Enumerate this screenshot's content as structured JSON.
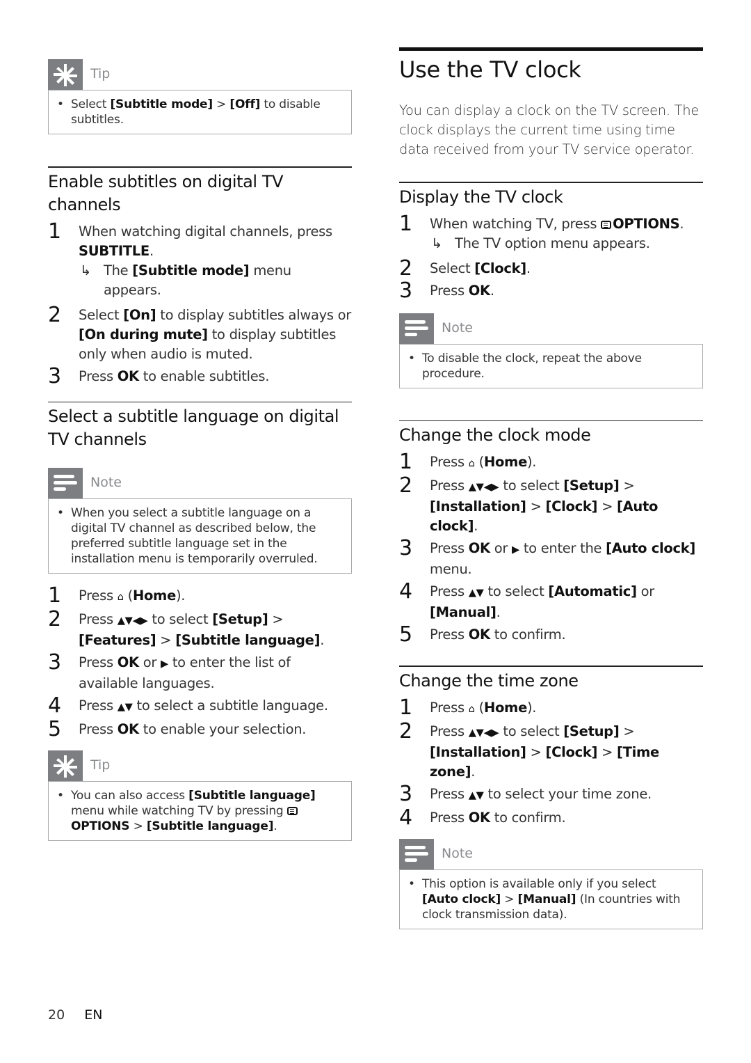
{
  "left": {
    "tip1": {
      "title": "Tip",
      "icon": "asterisk-icon",
      "items": [
        {
          "parts": [
            {
              "t": "Select ",
              "b": false
            },
            {
              "t": "[Subtitle mode]",
              "b": true
            },
            {
              "t": " > ",
              "b": false
            },
            {
              "t": "[Off]",
              "b": true
            },
            {
              "t": " to disable subtitles.",
              "b": false
            }
          ]
        }
      ]
    },
    "section1": {
      "title": "Enable subtitles on digital TV channels",
      "steps": [
        {
          "num": "1",
          "parts": [
            {
              "t": "When watching digital channels, press ",
              "b": false
            },
            {
              "t": "SUBTITLE",
              "b": true
            },
            {
              "t": ".",
              "b": false
            }
          ],
          "result": [
            {
              "t": "The ",
              "b": false
            },
            {
              "t": "[Subtitle mode]",
              "b": true
            },
            {
              "t": " menu appears.",
              "b": false
            }
          ]
        },
        {
          "num": "2",
          "parts": [
            {
              "t": "Select ",
              "b": false
            },
            {
              "t": "[On]",
              "b": true
            },
            {
              "t": " to display subtitles always or ",
              "b": false
            },
            {
              "t": "[On during mute]",
              "b": true
            },
            {
              "t": " to display subtitles only when audio is muted.",
              "b": false
            }
          ]
        },
        {
          "num": "3",
          "parts": [
            {
              "t": "Press ",
              "b": false
            },
            {
              "t": "OK",
              "b": true
            },
            {
              "t": " to enable subtitles.",
              "b": false
            }
          ]
        }
      ]
    },
    "section2": {
      "title": "Select a subtitle language on digital TV channels",
      "note": {
        "title": "Note",
        "icon": "note-lines-icon",
        "items": [
          {
            "parts": [
              {
                "t": "When you select a subtitle language on a digital TV channel as described below, the preferred subtitle language set in the installation menu is temporarily overruled.",
                "b": false
              }
            ]
          }
        ]
      },
      "steps": [
        {
          "num": "1",
          "parts": [
            {
              "t": "Press ",
              "b": false
            },
            {
              "t": "⌂",
              "b": false,
              "icon": "home-icon"
            },
            {
              "t": " (",
              "b": false
            },
            {
              "t": "Home",
              "b": true
            },
            {
              "t": ").",
              "b": false
            }
          ]
        },
        {
          "num": "2",
          "parts": [
            {
              "t": "Press ",
              "b": false
            },
            {
              "t": "▲▼◀▶",
              "b": false,
              "icon": "navigation-arrows-icon"
            },
            {
              "t": " to select ",
              "b": false
            },
            {
              "t": "[Setup]",
              "b": true
            },
            {
              "t": " > ",
              "b": false
            },
            {
              "t": "[Features]",
              "b": true
            },
            {
              "t": " > ",
              "b": false
            },
            {
              "t": "[Subtitle language]",
              "b": true
            },
            {
              "t": ".",
              "b": false
            }
          ]
        },
        {
          "num": "3",
          "parts": [
            {
              "t": "Press ",
              "b": false
            },
            {
              "t": "OK",
              "b": true
            },
            {
              "t": " or ",
              "b": false
            },
            {
              "t": "▶",
              "b": false,
              "icon": "right-arrow-icon"
            },
            {
              "t": " to enter the list of available languages.",
              "b": false
            }
          ]
        },
        {
          "num": "4",
          "parts": [
            {
              "t": "Press ",
              "b": false
            },
            {
              "t": "▲▼",
              "b": false,
              "icon": "up-down-arrows-icon"
            },
            {
              "t": " to select a subtitle language.",
              "b": false
            }
          ]
        },
        {
          "num": "5",
          "parts": [
            {
              "t": "Press ",
              "b": false
            },
            {
              "t": "OK",
              "b": true
            },
            {
              "t": " to enable your selection.",
              "b": false
            }
          ]
        }
      ],
      "tip": {
        "title": "Tip",
        "icon": "asterisk-icon",
        "items": [
          {
            "parts": [
              {
                "t": "You can also access ",
                "b": false
              },
              {
                "t": "[Subtitle language]",
                "b": true
              },
              {
                "t": " menu while watching TV by pressing ",
                "b": false
              },
              {
                "t": "",
                "b": false,
                "icon": "options-icon"
              },
              {
                "t": "OPTIONS",
                "b": true
              },
              {
                "t": " > ",
                "b": false
              },
              {
                "t": "[Subtitle language]",
                "b": true
              },
              {
                "t": ".",
                "b": false
              }
            ]
          }
        ]
      }
    }
  },
  "right": {
    "main_title": "Use the TV clock",
    "intro": "You can display a clock on the TV screen. The clock displays the current time using time data received from your TV service operator.",
    "section1": {
      "title": "Display the TV clock",
      "steps": [
        {
          "num": "1",
          "parts": [
            {
              "t": "When watching TV, press ",
              "b": false
            },
            {
              "t": "",
              "b": false,
              "icon": "options-icon"
            },
            {
              "t": "OPTIONS",
              "b": true
            },
            {
              "t": ".",
              "b": false
            }
          ],
          "result": [
            {
              "t": "The TV option menu appears.",
              "b": false
            }
          ]
        },
        {
          "num": "2",
          "parts": [
            {
              "t": "Select ",
              "b": false
            },
            {
              "t": "[Clock]",
              "b": true
            },
            {
              "t": ".",
              "b": false
            }
          ]
        },
        {
          "num": "3",
          "parts": [
            {
              "t": "Press ",
              "b": false
            },
            {
              "t": "OK",
              "b": true
            },
            {
              "t": ".",
              "b": false
            }
          ]
        }
      ],
      "note": {
        "title": "Note",
        "icon": "note-lines-icon",
        "items": [
          {
            "parts": [
              {
                "t": "To disable the clock, repeat the above procedure.",
                "b": false
              }
            ]
          }
        ]
      }
    },
    "section2": {
      "title": "Change the clock mode",
      "steps": [
        {
          "num": "1",
          "parts": [
            {
              "t": "Press ",
              "b": false
            },
            {
              "t": "⌂",
              "b": false,
              "icon": "home-icon"
            },
            {
              "t": " (",
              "b": false
            },
            {
              "t": "Home",
              "b": true
            },
            {
              "t": ").",
              "b": false
            }
          ]
        },
        {
          "num": "2",
          "parts": [
            {
              "t": "Press ",
              "b": false
            },
            {
              "t": "▲▼◀▶",
              "b": false,
              "icon": "navigation-arrows-icon"
            },
            {
              "t": " to select ",
              "b": false
            },
            {
              "t": "[Setup]",
              "b": true
            },
            {
              "t": " > ",
              "b": false
            },
            {
              "t": "[Installation]",
              "b": true
            },
            {
              "t": " > ",
              "b": false
            },
            {
              "t": "[Clock]",
              "b": true
            },
            {
              "t": " > ",
              "b": false
            },
            {
              "t": "[Auto clock]",
              "b": true
            },
            {
              "t": ".",
              "b": false
            }
          ]
        },
        {
          "num": "3",
          "parts": [
            {
              "t": "Press ",
              "b": false
            },
            {
              "t": "OK",
              "b": true
            },
            {
              "t": " or ",
              "b": false
            },
            {
              "t": "▶",
              "b": false,
              "icon": "right-arrow-icon"
            },
            {
              "t": " to enter the ",
              "b": false
            },
            {
              "t": "[Auto clock]",
              "b": true
            },
            {
              "t": " menu.",
              "b": false
            }
          ]
        },
        {
          "num": "4",
          "parts": [
            {
              "t": "Press ",
              "b": false
            },
            {
              "t": "▲▼",
              "b": false,
              "icon": "up-down-arrows-icon"
            },
            {
              "t": " to select ",
              "b": false
            },
            {
              "t": "[Automatic]",
              "b": true
            },
            {
              "t": " or ",
              "b": false
            },
            {
              "t": "[Manual]",
              "b": true
            },
            {
              "t": ".",
              "b": false
            }
          ]
        },
        {
          "num": "5",
          "parts": [
            {
              "t": "Press ",
              "b": false
            },
            {
              "t": "OK",
              "b": true
            },
            {
              "t": " to confirm.",
              "b": false
            }
          ]
        }
      ]
    },
    "section3": {
      "title": "Change the time zone",
      "steps": [
        {
          "num": "1",
          "parts": [
            {
              "t": "Press ",
              "b": false
            },
            {
              "t": "⌂",
              "b": false,
              "icon": "home-icon"
            },
            {
              "t": " (",
              "b": false
            },
            {
              "t": "Home",
              "b": true
            },
            {
              "t": ").",
              "b": false
            }
          ]
        },
        {
          "num": "2",
          "parts": [
            {
              "t": "Press ",
              "b": false
            },
            {
              "t": "▲▼◀▶",
              "b": false,
              "icon": "navigation-arrows-icon"
            },
            {
              "t": " to select ",
              "b": false
            },
            {
              "t": "[Setup]",
              "b": true
            },
            {
              "t": " > ",
              "b": false
            },
            {
              "t": "[Installation]",
              "b": true
            },
            {
              "t": " > ",
              "b": false
            },
            {
              "t": "[Clock]",
              "b": true
            },
            {
              "t": " > ",
              "b": false
            },
            {
              "t": "[Time zone]",
              "b": true
            },
            {
              "t": ".",
              "b": false
            }
          ]
        },
        {
          "num": "3",
          "parts": [
            {
              "t": "Press ",
              "b": false
            },
            {
              "t": "▲▼",
              "b": false,
              "icon": "up-down-arrows-icon"
            },
            {
              "t": " to select your time zone.",
              "b": false
            }
          ]
        },
        {
          "num": "4",
          "parts": [
            {
              "t": "Press ",
              "b": false
            },
            {
              "t": "OK",
              "b": true
            },
            {
              "t": " to confirm.",
              "b": false
            }
          ]
        }
      ],
      "note": {
        "title": "Note",
        "icon": "note-lines-icon",
        "items": [
          {
            "parts": [
              {
                "t": "This option is available only if you select ",
                "b": false
              },
              {
                "t": "[Auto clock]",
                "b": true
              },
              {
                "t": " > ",
                "b": false
              },
              {
                "t": "[Manual]",
                "b": true
              },
              {
                "t": " (In countries with clock transmission data).",
                "b": false
              }
            ]
          }
        ]
      }
    }
  },
  "footer": {
    "page_number": "20",
    "language": "EN"
  },
  "colors": {
    "icon_box": "#7d7e81",
    "box_title": "#8a8b8e",
    "box_border": "#a9aaad",
    "text": "#333333",
    "heading": "#111111"
  }
}
